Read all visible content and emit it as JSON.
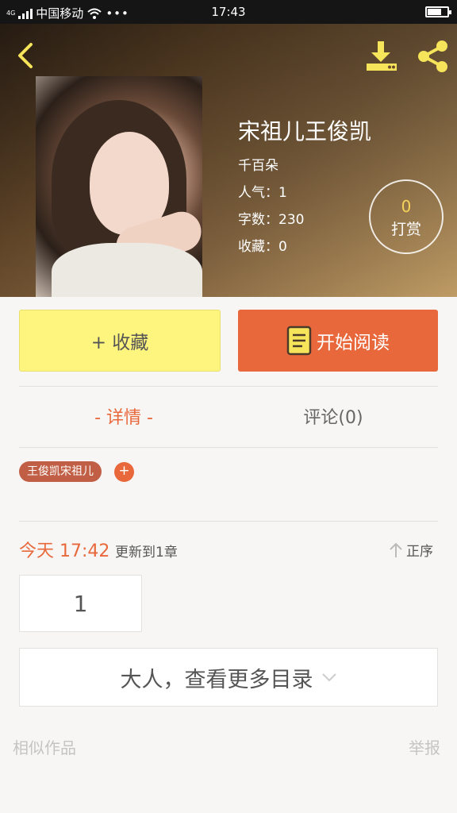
{
  "status_bar": {
    "network": "4G",
    "carrier": "中国移动",
    "time": "17:43",
    "battery_level_pct": 65
  },
  "book": {
    "title": "宋祖儿王俊凯",
    "author": "千百朵",
    "popularity": "人气：1",
    "word_count": "字数：230",
    "favorites": "收藏：0",
    "tip_count": "0",
    "tip_label": "打赏"
  },
  "actions": {
    "favorite_label": "+ 收藏",
    "read_label": "开始阅读"
  },
  "tabs": [
    {
      "label": "- 详情 -",
      "active": true
    },
    {
      "label": "评论(0)",
      "active": false
    }
  ],
  "tags": [
    "王俊凯宋祖儿"
  ],
  "tag_add_symbol": "+",
  "updates": {
    "time": "今天 17:42",
    "text": "更新到1章",
    "sort_label": "正序"
  },
  "chapters": [
    "1"
  ],
  "more_catalog_label": "大人，查看更多目录",
  "footer": {
    "similar_label": "相似作品",
    "report_label": "举报"
  },
  "colors": {
    "accent": "#e8683b",
    "favorite_bg": "#fef57e",
    "tip_number": "#f6d35a",
    "icon_yellow": "#f6e45a"
  },
  "icons": [
    "back-arrow-icon",
    "download-icon",
    "share-icon",
    "book-icon",
    "arrow-up-icon",
    "chevron-down-icon",
    "wifi-icon",
    "signal-icon"
  ]
}
